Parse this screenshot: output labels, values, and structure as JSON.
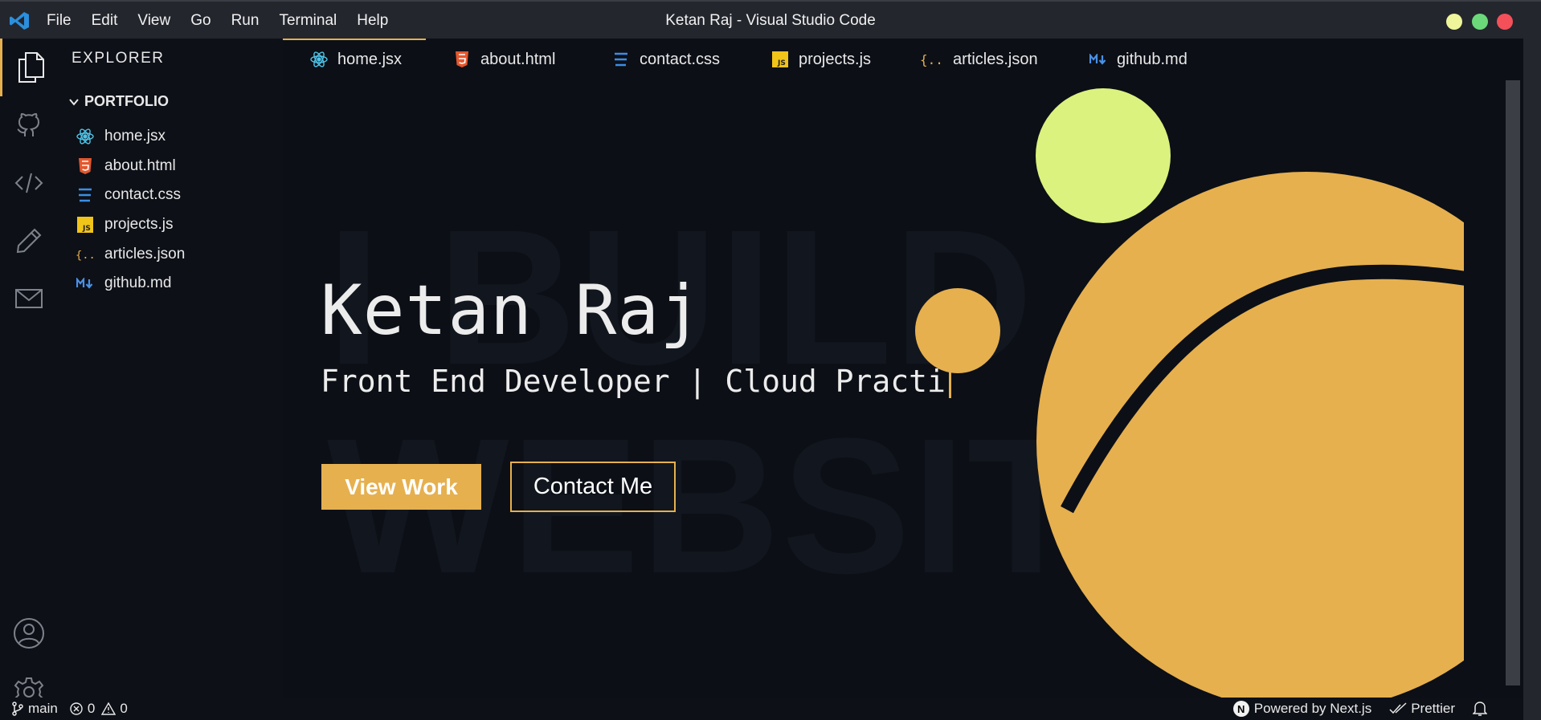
{
  "window": {
    "title": "Ketan Raj - Visual Studio Code",
    "menu": [
      "File",
      "Edit",
      "View",
      "Go",
      "Run",
      "Terminal",
      "Help"
    ]
  },
  "sidebar": {
    "title": "EXPLORER",
    "folder": "PORTFOLIO",
    "files": [
      {
        "name": "home.jsx",
        "icon": "react-icon"
      },
      {
        "name": "about.html",
        "icon": "html5-icon"
      },
      {
        "name": "contact.css",
        "icon": "css3-icon"
      },
      {
        "name": "projects.js",
        "icon": "js-icon"
      },
      {
        "name": "articles.json",
        "icon": "json-icon"
      },
      {
        "name": "github.md",
        "icon": "markdown-icon"
      }
    ]
  },
  "tabs": [
    {
      "label": "home.jsx",
      "active": true
    },
    {
      "label": "about.html"
    },
    {
      "label": "contact.css"
    },
    {
      "label": "projects.js"
    },
    {
      "label": "articles.json"
    },
    {
      "label": "github.md"
    }
  ],
  "hero": {
    "bg_line1": "I BUILD",
    "bg_line2": "WEBSITES",
    "name": "Ketan Raj",
    "subtitle": "Front End Developer | Cloud Practi",
    "primary_button": "View Work",
    "secondary_button": "Contact Me"
  },
  "statusbar": {
    "branch": "main",
    "errors": "0",
    "warnings": "0",
    "powered": "Powered by Next.js",
    "formatter": "Prettier"
  },
  "colors": {
    "accent": "#e6b04f",
    "lime": "#dbf27f",
    "background": "#0c0f16",
    "titlebar": "#23262d"
  }
}
